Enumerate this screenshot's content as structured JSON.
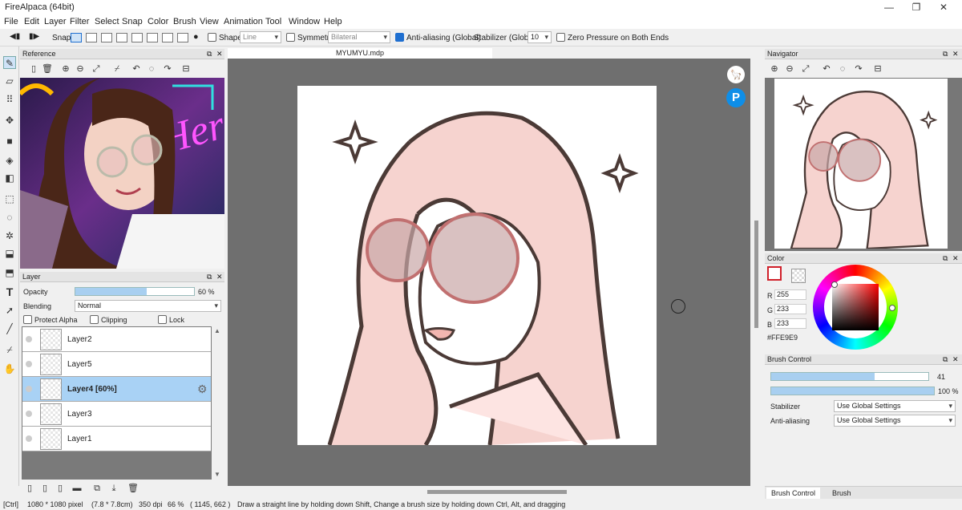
{
  "window": {
    "title": "FireAlpaca (64bit)",
    "minimize": "—",
    "maximize": "❐",
    "close": "✕"
  },
  "menu": [
    "File",
    "Edit",
    "Layer",
    "Filter",
    "Select",
    "Snap",
    "Color",
    "Brush",
    "View",
    "Animation",
    "Tool",
    "Window",
    "Help"
  ],
  "toolbar": {
    "snap_label": "Snap",
    "shape_label": "Shape",
    "shape_value": "Line",
    "symmetry_label": "Symmetry",
    "symmetry_value": "Bilateral",
    "antialias_label": "Anti-aliasing (Global)",
    "stabilizer_label": "Stabilizer (Global)",
    "stabilizer_value": "10",
    "zero_pressure_label": "Zero Pressure on Both Ends"
  },
  "reference": {
    "title": "Reference"
  },
  "layer_panel": {
    "title": "Layer",
    "opacity_label": "Opacity",
    "opacity_value": "60 %",
    "opacity_fraction": 0.6,
    "blending_label": "Blending",
    "blending_value": "Normal",
    "protect_alpha": "Protect Alpha",
    "clipping": "Clipping",
    "lock": "Lock",
    "layers": [
      {
        "name": "Layer2",
        "active": false
      },
      {
        "name": "Layer5",
        "active": false
      },
      {
        "name": "Layer4 [60%]",
        "active": true
      },
      {
        "name": "Layer3",
        "active": false
      },
      {
        "name": "Layer1",
        "active": false
      }
    ]
  },
  "document": {
    "tab": "MYUMYU.mdp"
  },
  "navigator": {
    "title": "Navigator"
  },
  "color": {
    "title": "Color",
    "r_label": "R",
    "r": "255",
    "g_label": "G",
    "g": "233",
    "b_label": "B",
    "b": "233",
    "hex": "#FFE9E9",
    "primary": "#ffffff",
    "primary_border": "#d0202a"
  },
  "brush_control": {
    "title": "Brush Control",
    "size_value": "41",
    "size_fraction": 0.66,
    "opacity_value": "100 %",
    "opacity_fraction": 1.0,
    "stabilizer_label": "Stabilizer",
    "stabilizer_value": "Use Global Settings",
    "antialias_label": "Anti-aliasing",
    "antialias_value": "Use Global Settings",
    "tab1": "Brush Control",
    "tab2": "Brush"
  },
  "status": {
    "key": "[Ctrl]",
    "size": "1080 * 1080 pixel",
    "physical": "(7.8 * 7.8cm)",
    "dpi": "350 dpi",
    "zoom": "66 %",
    "coords": "( 1145, 662 )",
    "hint": "Draw a straight line by holding down Shift, Change a brush size by holding down Ctrl, Alt, and dragging"
  }
}
